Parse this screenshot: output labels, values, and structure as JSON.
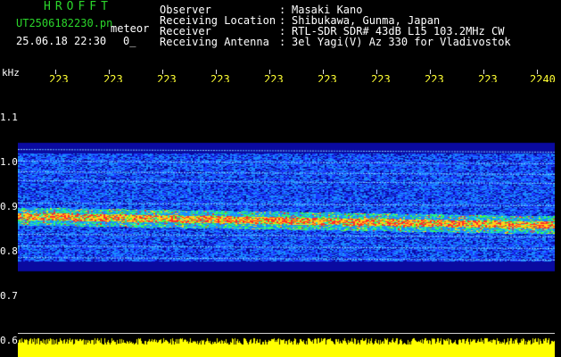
{
  "header": {
    "title": "HROFFT",
    "file_name": "UT2506182230.pn",
    "mode": "meteor",
    "date_time": "25.06.18 22:30",
    "status": "0_"
  },
  "info": [
    {
      "label": "Observer",
      "sep": ":",
      "value": "Masaki Kano"
    },
    {
      "label": "Receiving Location",
      "sep": ":",
      "value": "Shibukawa, Gunma, Japan"
    },
    {
      "label": "Receiver",
      "sep": ":",
      "value": "RTL-SDR SDR# 43dB L15 103.2MHz CW"
    },
    {
      "label": "Receiving Antenna",
      "sep": ":",
      "value": "3el Yagi(V) Az 330 for Vladivostok"
    }
  ],
  "axes": {
    "y_unit": "kHz",
    "x_ticks": [
      "223",
      "223",
      "223",
      "223",
      "223",
      "223",
      "223",
      "223",
      "223",
      "2240"
    ],
    "y_ticks": [
      "1.1",
      "1.0",
      "0.9",
      "0.8",
      "0.7",
      "0.6"
    ]
  },
  "colors": {
    "header_title": "#2bd62b",
    "axis_ticks_x": "#ffff33",
    "echo_band": "#ffff00"
  }
}
